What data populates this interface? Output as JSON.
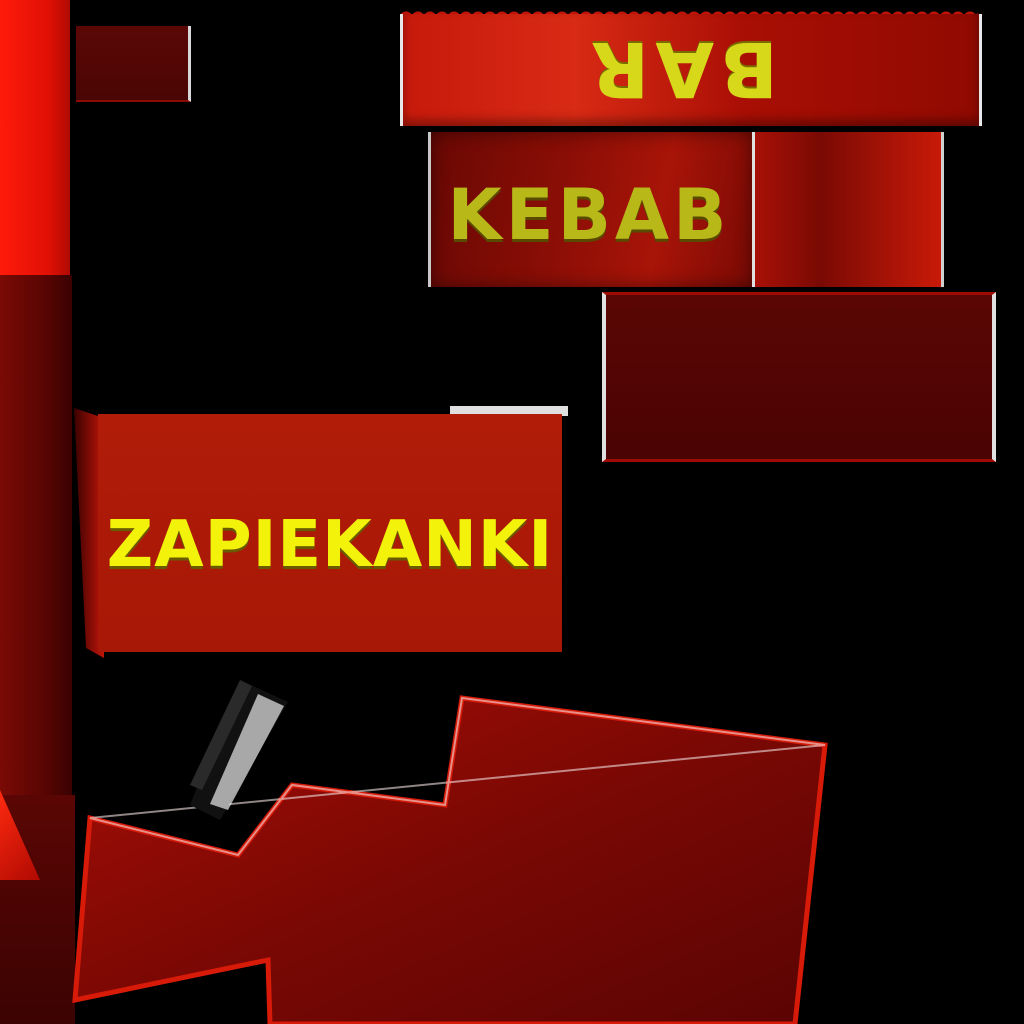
{
  "signs": {
    "bar": "BAR",
    "kebab": "KEBAB",
    "zapiekanki": "ZAPIEKANKI"
  },
  "colors": {
    "background": "#000000",
    "sign_red": "#b01c08",
    "text_yellow": "#f2f20a",
    "dark_red": "#4a0403"
  }
}
